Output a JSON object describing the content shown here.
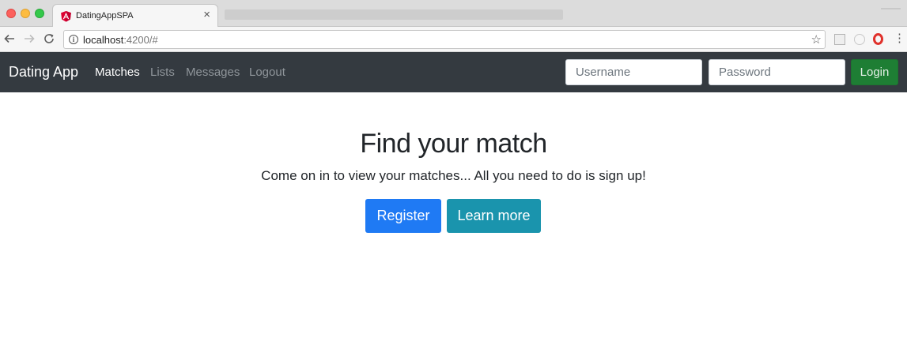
{
  "browser": {
    "tab_title": "DatingAppSPA",
    "tab_close": "×",
    "favicon": "angular-icon",
    "url_host": "localhost",
    "url_rest": ":4200/#",
    "icons": {
      "back": "arrow-left-icon",
      "forward": "arrow-right-icon",
      "reload": "reload-icon",
      "info": "info-icon",
      "bookmark": "star-icon",
      "menu": "more-vertical-icon",
      "extension_opera": "opera-icon"
    }
  },
  "navbar": {
    "brand": "Dating App",
    "links": [
      {
        "label": "Matches",
        "active": true
      },
      {
        "label": "Lists",
        "active": false
      },
      {
        "label": "Messages",
        "active": false
      },
      {
        "label": "Logout",
        "active": false
      }
    ],
    "username_placeholder": "Username",
    "password_placeholder": "Password",
    "login_label": "Login"
  },
  "hero": {
    "title": "Find your match",
    "lead": "Come on in to view your matches... All you need to do is sign up!",
    "register_label": "Register",
    "learn_more_label": "Learn more"
  },
  "colors": {
    "navbar_bg": "#343a40",
    "primary": "#1f7af4",
    "info": "#1a94ad",
    "success": "#1e7e34"
  }
}
